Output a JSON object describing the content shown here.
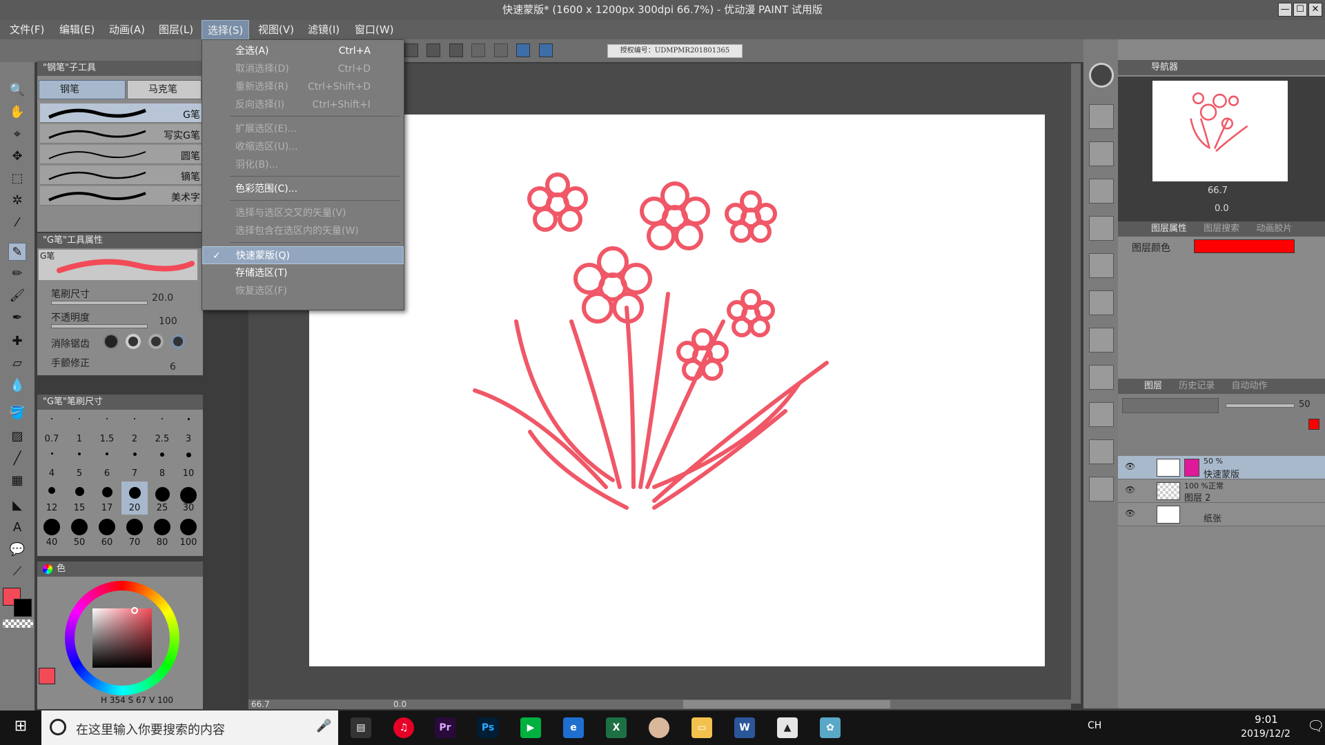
{
  "title": "快速蒙版* (1600 x 1200px 300dpi 66.7%) - 优动漫 PAINT 试用版",
  "window_controls": [
    "—",
    "☐",
    "✕"
  ],
  "menubar": [
    "文件(F)",
    "编辑(E)",
    "动画(A)",
    "图层(L)",
    "选择(S)",
    "视图(V)",
    "滤镜(I)",
    "窗口(W)"
  ],
  "active_menu_index": 4,
  "dropdown": {
    "items": [
      {
        "label": "全选(A)",
        "shortcut": "Ctrl+A",
        "disabled": false
      },
      {
        "label": "取消选择(D)",
        "shortcut": "Ctrl+D",
        "disabled": true
      },
      {
        "label": "重新选择(R)",
        "shortcut": "Ctrl+Shift+D",
        "disabled": true
      },
      {
        "label": "反向选择(I)",
        "shortcut": "Ctrl+Shift+I",
        "disabled": true
      },
      {
        "label": "扩展选区(E)...",
        "shortcut": "",
        "disabled": true
      },
      {
        "label": "收缩选区(U)...",
        "shortcut": "",
        "disabled": true
      },
      {
        "label": "羽化(B)...",
        "shortcut": "",
        "disabled": true
      },
      {
        "label": "色彩范围(C)...",
        "shortcut": "",
        "disabled": false
      },
      {
        "label": "选择与选区交叉的矢量(V)",
        "shortcut": "",
        "disabled": true
      },
      {
        "label": "选择包含在选区内的矢量(W)",
        "shortcut": "",
        "disabled": true
      },
      {
        "label": "快速蒙版(Q)",
        "shortcut": "",
        "disabled": false,
        "checked": true
      },
      {
        "label": "存储选区(T)",
        "shortcut": "",
        "disabled": false
      },
      {
        "label": "恢复选区(F)",
        "shortcut": "",
        "disabled": true
      }
    ]
  },
  "license_label": "授权编号：UDMPMR201801365",
  "subtool": {
    "header": "\"钢笔\"子工具",
    "tabs": [
      "钢笔",
      "马克笔"
    ],
    "brushes": [
      "G笔",
      "写实G笔",
      "圆笔",
      "镝笔",
      "美术字"
    ]
  },
  "tool_property": {
    "header": "\"G笔\"工具属性",
    "preview_label": "G笔",
    "brush_size_label": "笔刷尺寸",
    "brush_size_value": "20.0",
    "opacity_label": "不透明度",
    "opacity_value": "100",
    "antialias_label": "消除锯齿",
    "stabilization_label": "手颤修正",
    "stabilization_value": "6"
  },
  "brush_size_panel": {
    "header": "\"G笔\"笔刷尺寸",
    "sizes": [
      "0.7",
      "1",
      "1.5",
      "2",
      "2.5",
      "3",
      "4",
      "5",
      "6",
      "7",
      "8",
      "10",
      "12",
      "15",
      "17",
      "20",
      "25",
      "30",
      "40",
      "50",
      "60",
      "70",
      "80",
      "100"
    ],
    "selected": "20"
  },
  "color": {
    "header": "色",
    "main_color": "#f24a57",
    "sub_color": "#000000",
    "h": "354",
    "s": "67",
    "v": "100"
  },
  "navigator": {
    "header": "导航器",
    "zoom": "66.7",
    "rotation": "0.0"
  },
  "layer_property": {
    "tabs": [
      "图层属性",
      "图层搜索",
      "动画胶片"
    ],
    "layer_color_label": "图层颜色",
    "layer_color": "#ff0000"
  },
  "layers_panel": {
    "tabs": [
      "图层",
      "历史记录",
      "自动动作"
    ],
    "opacity_value": "50",
    "layers": [
      {
        "opacity": "50 %",
        "name": "快速蒙版",
        "selected": true
      },
      {
        "opacity": "100 %正常",
        "name": "图层 2",
        "selected": false
      },
      {
        "opacity": "",
        "name": "纸张",
        "selected": false
      }
    ]
  },
  "status": {
    "zoom": "66.7",
    "rotation": "0.0"
  },
  "taskbar": {
    "search_placeholder": "在这里输入你要搜索的内容",
    "ime": "CH",
    "time": "9:01",
    "date": "2019/12/2"
  }
}
